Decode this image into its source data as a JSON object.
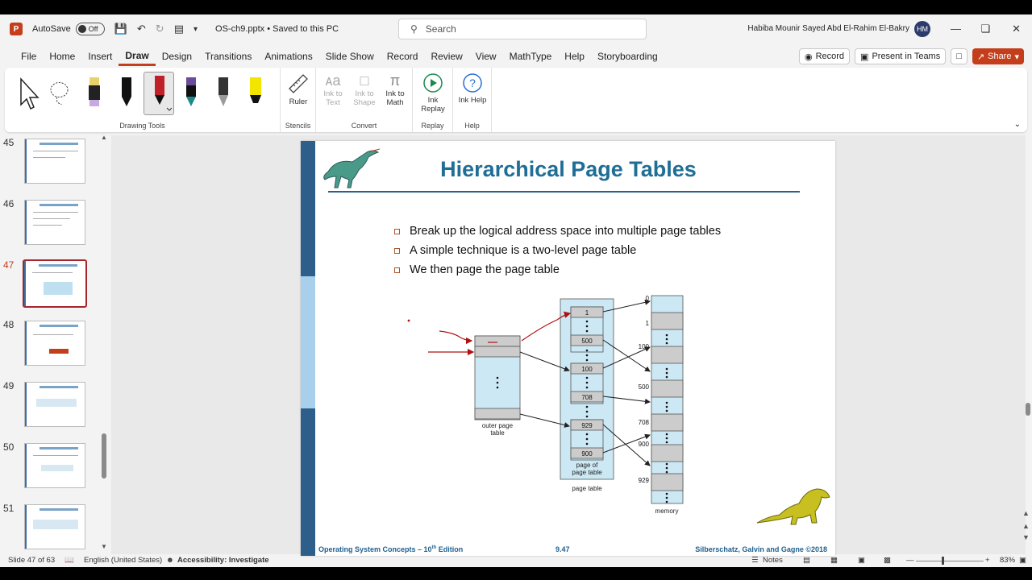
{
  "titlebar": {
    "app_letter": "P",
    "autosave_label": "AutoSave",
    "autosave_state": "Off",
    "document": "OS-ch9.pptx • Saved to this PC",
    "search_placeholder": "Search",
    "user_name": "Habiba Mounir Sayed Abd El-Rahim El-Bakry",
    "user_initials": "HM"
  },
  "menu": {
    "tabs": [
      "File",
      "Home",
      "Insert",
      "Draw",
      "Design",
      "Transitions",
      "Animations",
      "Slide Show",
      "Record",
      "Review",
      "View",
      "MathType",
      "Help",
      "Storyboarding"
    ],
    "active_tab": "Draw",
    "record_label": "Record",
    "present_label": "Present in Teams",
    "share_label": "Share"
  },
  "ribbon": {
    "drawing_tools_label": "Drawing Tools",
    "ruler_label": "Ruler",
    "stencils_label": "Stencils",
    "ink_to_text": "Ink to Text",
    "ink_to_shape": "Ink to Shape",
    "ink_to_math": "Ink to Math",
    "convert_label": "Convert",
    "ink_replay": "Ink Replay",
    "replay_label": "Replay",
    "ink_help": "Ink Help",
    "help_label": "Help",
    "pen_colors": [
      "#e8d16a",
      "#111111",
      "#c0202a",
      "#1f8a8a",
      "#7a7a7a",
      "#f2e600"
    ]
  },
  "thumbnails": {
    "numbers": [
      "45",
      "46",
      "47",
      "48",
      "49",
      "50",
      "51"
    ],
    "current": "47"
  },
  "slide": {
    "title": "Hierarchical Page Tables",
    "bullets": [
      "Break up the logical address space into multiple page tables",
      "A simple technique is a two-level page table",
      "We then page the page table"
    ],
    "footer_left": "Operating System Concepts – 10",
    "footer_left_sup": "th",
    "footer_left_end": " Edition",
    "footer_mid": "9.47",
    "footer_right": "Silberschatz, Galvin and Gagne ©2018",
    "diagram": {
      "outer_label_1": "outer page",
      "outer_label_2": "table",
      "pop_label_1": "page of",
      "pop_label_2": "page table",
      "page_table_label": "page table",
      "memory_label": "memory",
      "pop_entries": [
        "1",
        "500",
        "100",
        "708",
        "929",
        "900"
      ],
      "memory_addresses": [
        "0",
        "1",
        "100",
        "500",
        "708",
        "900",
        "929"
      ],
      "accent_fill": "#cce8f4",
      "gray_fill": "#cccccc"
    }
  },
  "status": {
    "slide_info": "Slide 47 of 63",
    "language": "English (United States)",
    "accessibility": "Accessibility: Investigate",
    "notes": "Notes",
    "zoom": "83%"
  }
}
